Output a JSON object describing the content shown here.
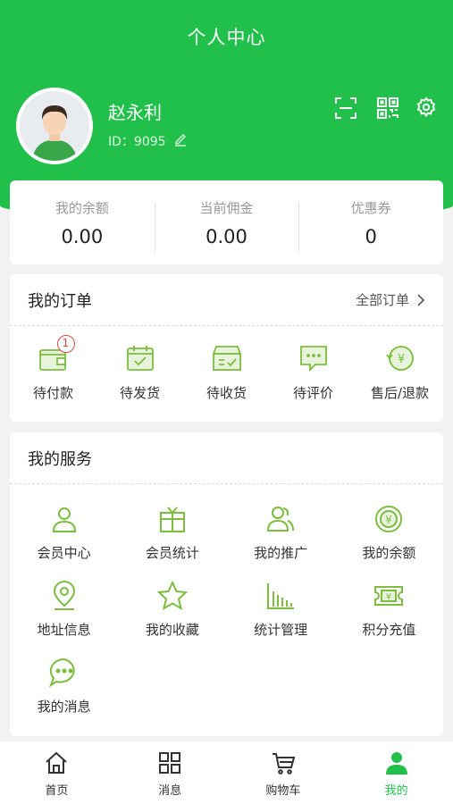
{
  "header": {
    "title": "个人中心",
    "user_name": "赵永利",
    "user_id": "ID：9095",
    "icons": [
      "scan-icon",
      "qrcode-icon",
      "settings-icon"
    ]
  },
  "stats": [
    {
      "label": "我的余额",
      "value": "0.00"
    },
    {
      "label": "当前佣金",
      "value": "0.00"
    },
    {
      "label": "优惠券",
      "value": "0"
    }
  ],
  "orders": {
    "title": "我的订单",
    "all_label": "全部订单",
    "items": [
      {
        "label": "待付款",
        "icon": "wallet-icon",
        "badge": "1"
      },
      {
        "label": "待发货",
        "icon": "calendar-check-icon"
      },
      {
        "label": "待收货",
        "icon": "box-icon"
      },
      {
        "label": "待评价",
        "icon": "chat-icon"
      },
      {
        "label": "售后/退款",
        "icon": "refund-icon"
      }
    ]
  },
  "services": {
    "title": "我的服务",
    "items": [
      {
        "label": "会员中心",
        "icon": "user-icon"
      },
      {
        "label": "会员统计",
        "icon": "gift-icon"
      },
      {
        "label": "我的推广",
        "icon": "users-icon"
      },
      {
        "label": "我的余额",
        "icon": "coin-icon"
      },
      {
        "label": "地址信息",
        "icon": "location-icon"
      },
      {
        "label": "我的收藏",
        "icon": "star-icon"
      },
      {
        "label": "统计管理",
        "icon": "bar-chart-icon"
      },
      {
        "label": "积分充值",
        "icon": "ticket-icon"
      },
      {
        "label": "我的消息",
        "icon": "message-icon"
      }
    ]
  },
  "tabbar": {
    "items": [
      {
        "label": "首页",
        "icon": "home-icon"
      },
      {
        "label": "消息",
        "icon": "grid-icon"
      },
      {
        "label": "购物车",
        "icon": "cart-icon"
      },
      {
        "label": "我的",
        "icon": "person-icon",
        "active": true
      }
    ]
  },
  "colors": {
    "brand": "#21c04a",
    "icon_green": "#7cbd3e",
    "badge_red": "#e04848"
  }
}
